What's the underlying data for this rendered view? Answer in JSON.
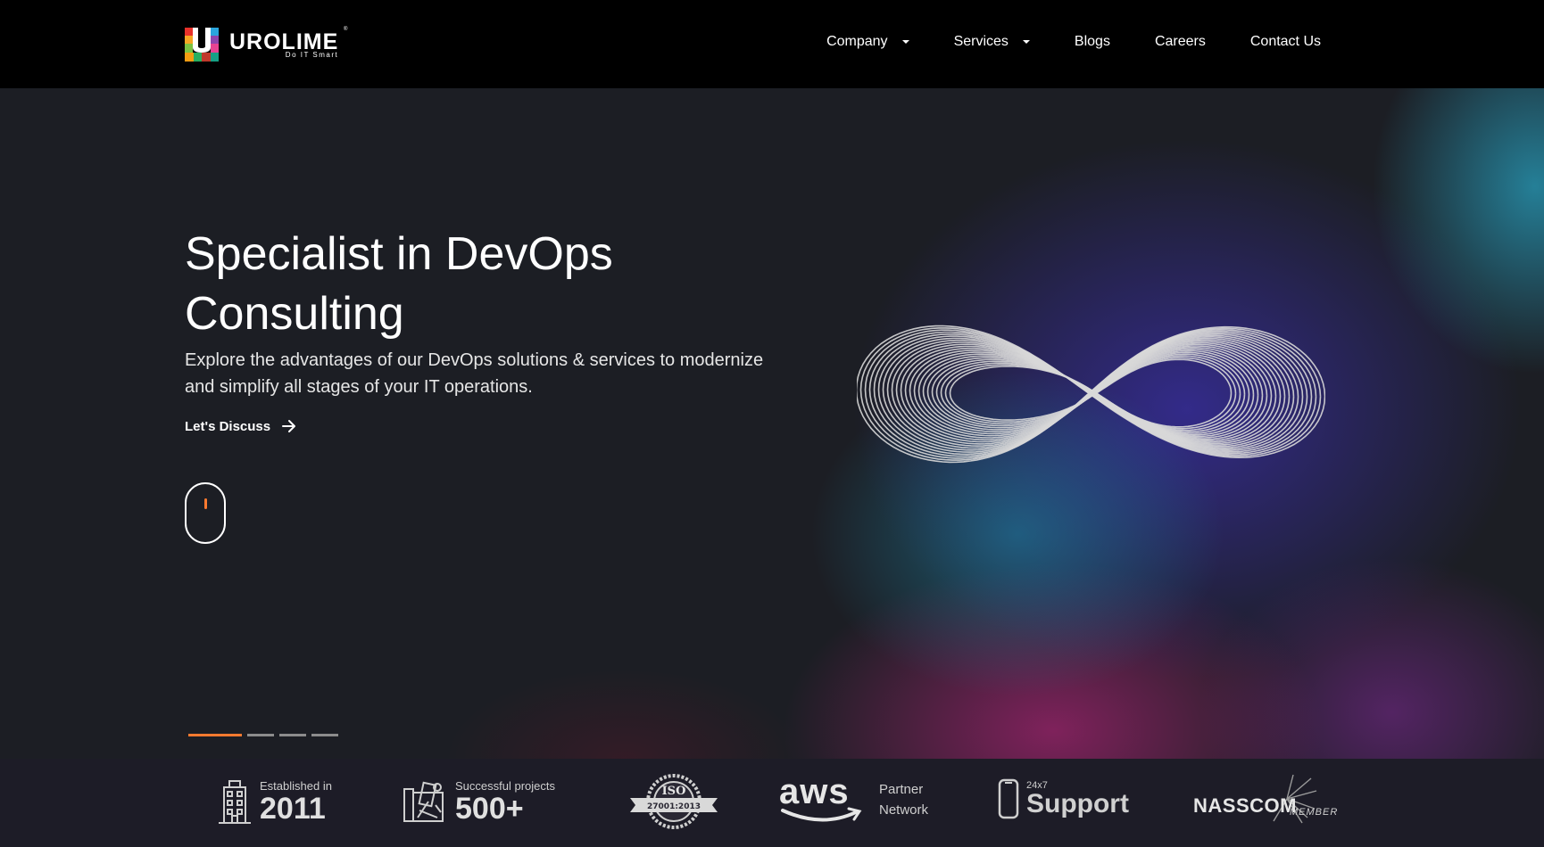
{
  "brand": {
    "name": "UROLIME",
    "tagline": "Do IT Smart",
    "registered_mark": "®"
  },
  "nav": {
    "items": [
      {
        "label": "Company",
        "has_dropdown": true
      },
      {
        "label": "Services",
        "has_dropdown": true
      },
      {
        "label": "Blogs",
        "has_dropdown": false
      },
      {
        "label": "Careers",
        "has_dropdown": false
      },
      {
        "label": "Contact Us",
        "has_dropdown": false
      }
    ]
  },
  "hero": {
    "title_line1": "Specialist in DevOps",
    "title_line2": "Consulting",
    "description": "Explore the advantages of our DevOps solutions & services to modernize and simplify all stages of your IT operations.",
    "cta_label": "Let's Discuss",
    "slides_count": 4,
    "active_slide": 1
  },
  "stats": {
    "established": {
      "label": "Established in",
      "value": "2011",
      "icon": "building-icon"
    },
    "projects": {
      "label": "Successful projects",
      "value": "500+",
      "icon": "blueprint-icon"
    },
    "iso": {
      "top": "ISO",
      "bottom": "27001:2013",
      "icon": "iso-badge-icon"
    },
    "aws": {
      "word": "aws",
      "line1": "Partner",
      "line2": "Network"
    },
    "support": {
      "small": "24x7",
      "big": "Support",
      "icon": "phone-icon"
    },
    "nasscom": {
      "name": "NASSCOM",
      "sub": "MEMBER"
    }
  },
  "colors": {
    "accent": "#ff7a2f",
    "header_bg": "#000000",
    "hero_bg": "#1c1e24"
  }
}
